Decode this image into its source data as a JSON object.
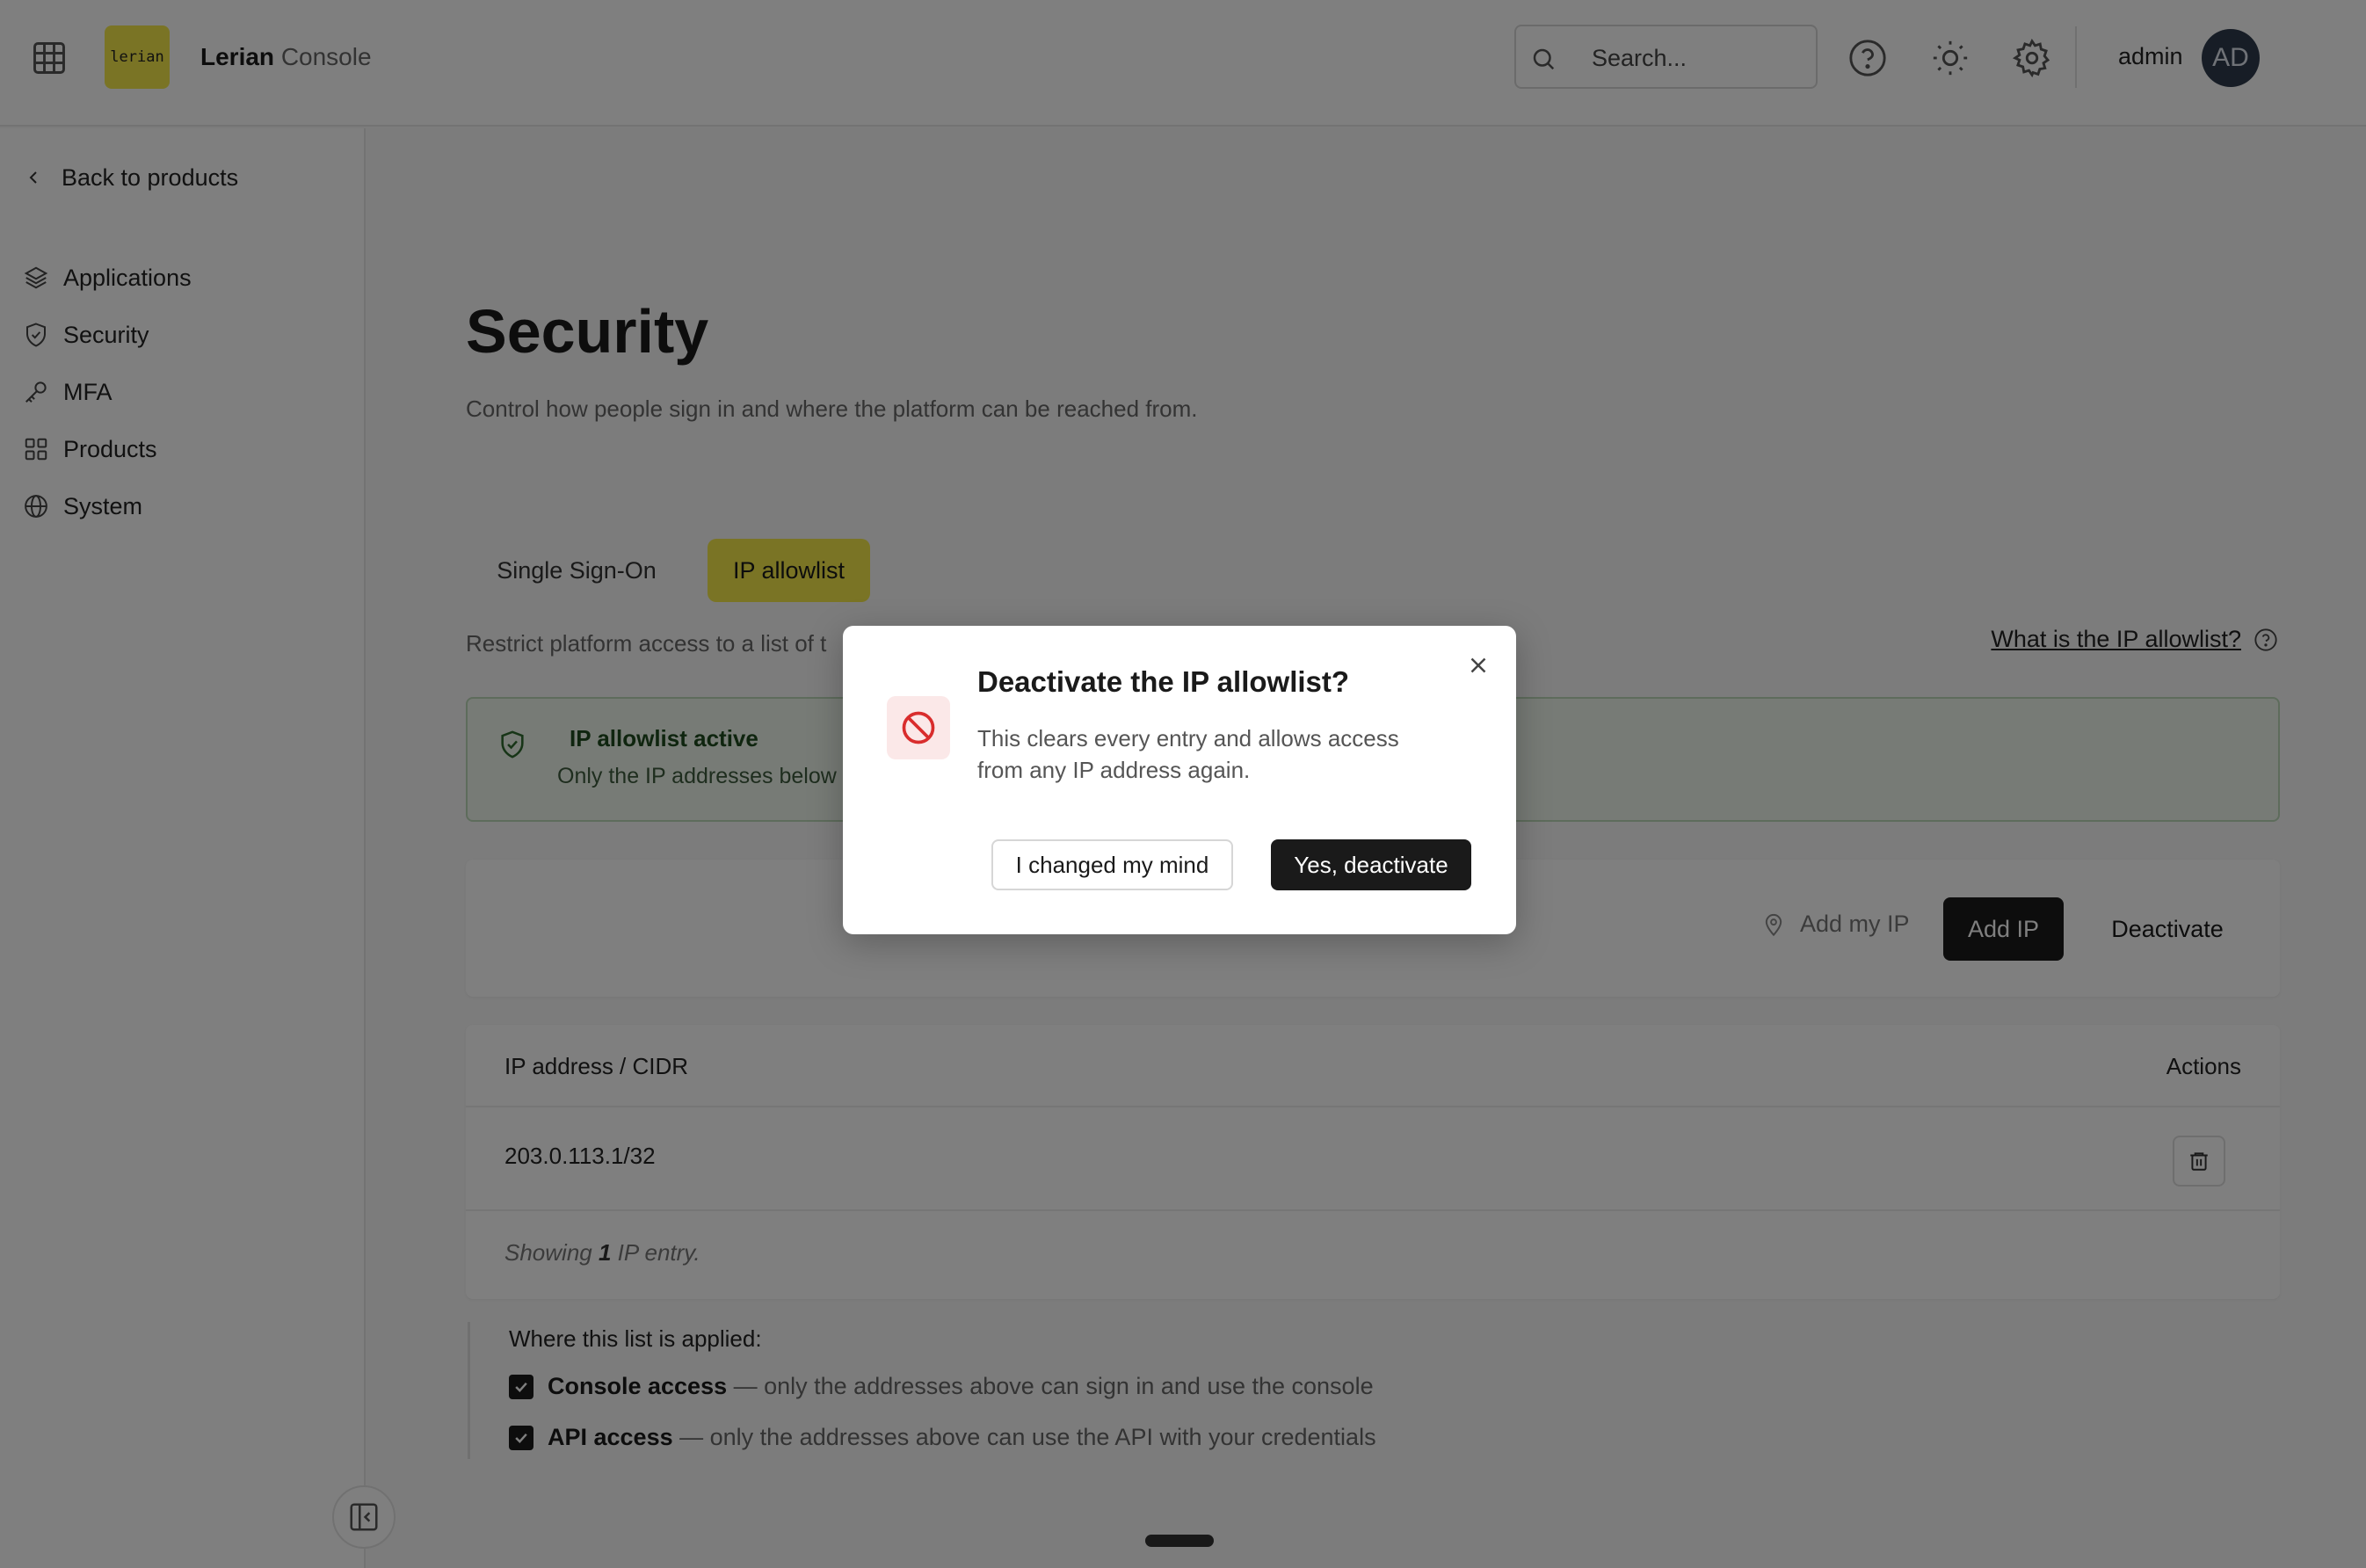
{
  "header": {
    "logo_text": "lerian",
    "brand_name": "Lerian",
    "brand_suffix": "Console",
    "search_placeholder": "Search...",
    "user_name": "admin",
    "avatar_initials": "AD"
  },
  "sidebar": {
    "back_label": "Back to products",
    "items": [
      {
        "label": "Applications",
        "icon": "layers-icon"
      },
      {
        "label": "Security",
        "icon": "shield-icon"
      },
      {
        "label": "MFA",
        "icon": "key-icon"
      },
      {
        "label": "Products",
        "icon": "grid-icon"
      },
      {
        "label": "System",
        "icon": "globe-icon"
      }
    ]
  },
  "main": {
    "title": "Security",
    "description": "Control how people sign in and where the platform can be reached from.",
    "tabs": [
      {
        "label": "Single Sign-On",
        "active": false
      },
      {
        "label": "IP allowlist",
        "active": true
      }
    ],
    "restrict_text": "Restrict platform access to a list of t",
    "help_link": "What is the IP allowlist?",
    "alert": {
      "title": "IP allowlist active",
      "text": "Only the IP addresses below c"
    },
    "toolbar": {
      "add_my_ip": "Add my IP",
      "add_ip": "Add IP",
      "deactivate": "Deactivate"
    },
    "table": {
      "columns": [
        "IP address / CIDR",
        "Actions"
      ],
      "rows": [
        {
          "ip": "203.0.113.1/32"
        }
      ],
      "footer_prefix": "Showing ",
      "footer_count": "1",
      "footer_suffix": " IP entry."
    },
    "applied": {
      "heading": "Where this list is applied:",
      "items": [
        {
          "label": "Console access",
          "rest": " — only the addresses above can sign in and use the console",
          "checked": true
        },
        {
          "label": "API access",
          "rest": " — only the addresses above can use the API with your credentials",
          "checked": true
        }
      ]
    }
  },
  "modal": {
    "title": "Deactivate the IP allowlist?",
    "body": "This clears every entry and allows access from any IP address again.",
    "cancel_label": "I changed my mind",
    "confirm_label": "Yes, deactivate",
    "icon": "ban-icon"
  },
  "colors": {
    "accent": "#f4e94a",
    "success_bg": "#eef6ec",
    "danger": "#d92d2d",
    "dark_button": "#1a1a1a"
  }
}
